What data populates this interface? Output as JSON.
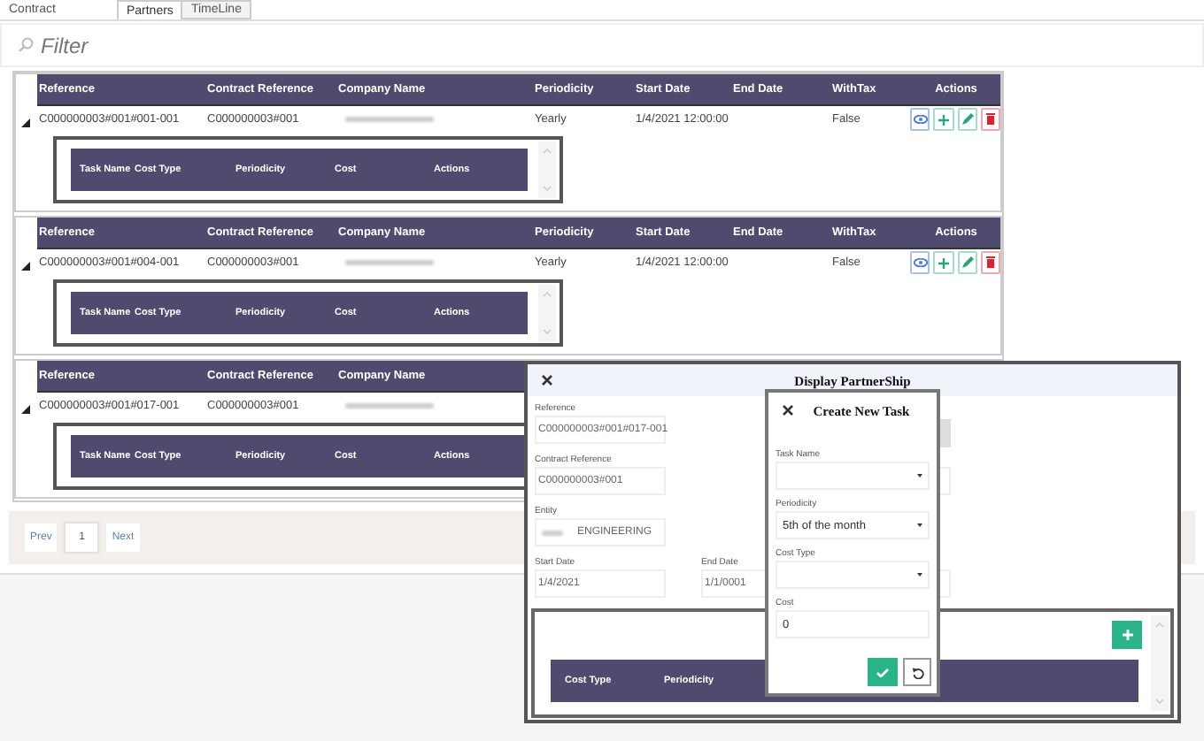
{
  "tabs": [
    {
      "label": "Contract",
      "selected": false
    },
    {
      "label": "Partners",
      "selected": true
    },
    {
      "label": "TimeLine",
      "selected": false
    }
  ],
  "filter": {
    "placeholder": "Filter"
  },
  "partners": [
    {
      "expanded": true,
      "columns": [
        "Reference",
        "Contract Reference",
        "Company Name",
        "Periodicity",
        "Start Date",
        "End Date",
        "WithTax",
        "Actions"
      ],
      "row": {
        "reference": "C000000003#001#001-001",
        "contract_reference": "C000000003#001",
        "periodicity": "Yearly",
        "start_date": "1/4/2021 12:00:00",
        "with_tax": "False"
      },
      "actions": [
        {
          "kind": "view"
        },
        {
          "kind": "add"
        },
        {
          "kind": "edit"
        },
        {
          "kind": "delete"
        }
      ],
      "task_columns": [
        "Task Name",
        "Cost Type",
        "Periodicity",
        "Cost",
        "Actions"
      ]
    },
    {
      "expanded": true,
      "columns": [
        "Reference",
        "Contract Reference",
        "Company Name",
        "Periodicity",
        "Start Date",
        "End Date",
        "WithTax",
        "Actions"
      ],
      "row": {
        "reference": "C000000003#001#004-001",
        "contract_reference": "C000000003#001",
        "periodicity": "Yearly",
        "start_date": "1/4/2021 12:00:00",
        "with_tax": "False"
      },
      "actions": [
        {
          "kind": "view"
        },
        {
          "kind": "add"
        },
        {
          "kind": "edit"
        },
        {
          "kind": "delete"
        }
      ],
      "task_columns": [
        "Task Name",
        "Cost Type",
        "Periodicity",
        "Cost",
        "Actions"
      ]
    },
    {
      "expanded": true,
      "columns": [
        "Reference",
        "Contract Reference",
        "Company Name"
      ],
      "row": {
        "reference": "C000000003#001#017-001",
        "contract_reference": "C000000003#001"
      },
      "task_columns": [
        "Task Name",
        "Cost Type",
        "Periodicity",
        "Cost",
        "Actions"
      ]
    }
  ],
  "pagination": {
    "prev": "Prev",
    "pages": [
      {
        "label": "1",
        "selected": true
      }
    ],
    "next": "Next"
  },
  "partnership_dialog": {
    "title": "Display PartnerShip",
    "fields": [
      {
        "label": "Reference",
        "value": "C000000003#001#017-001"
      },
      {
        "label": "Contract Reference",
        "value": "C000000003#001"
      },
      {
        "label": "Entity",
        "value": "ENGINEERING"
      }
    ],
    "dates": [
      {
        "label": "Start Date",
        "value": "1/4/2021"
      },
      {
        "label": "End Date",
        "value": "1/1/0001"
      }
    ],
    "task_columns": [
      "Cost Type",
      "Periodicity"
    ]
  },
  "task_dialog": {
    "title": "Create New Task",
    "fields": [
      {
        "label": "Task Name",
        "kind": "select"
      },
      {
        "label": "Periodicity",
        "kind": "select",
        "value": "5th of the month"
      },
      {
        "label": "Cost Type",
        "kind": "select"
      },
      {
        "label": "Cost",
        "kind": "input",
        "value": "0"
      }
    ]
  }
}
